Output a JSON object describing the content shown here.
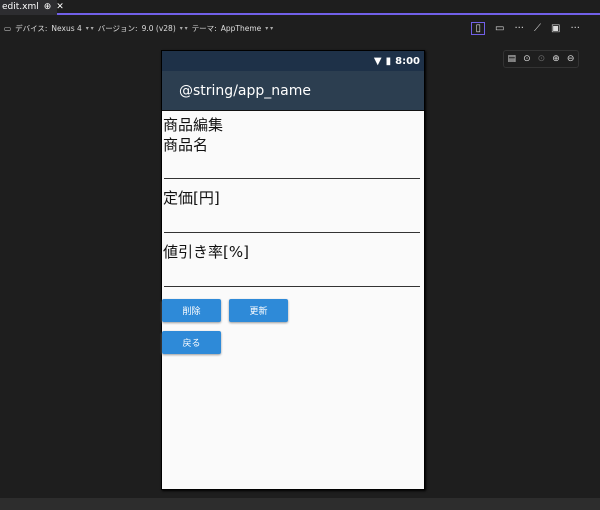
{
  "tab": {
    "title": "edit.xml",
    "pin": "⊕",
    "close": "✕"
  },
  "toolbar": {
    "device_label": "デバイス:",
    "device": "Nexus 4",
    "version_label": "バージョン:",
    "version": "9.0 (v28)",
    "theme_label": "テーマ:",
    "theme": "AppTheme",
    "dd": "▾ ▾",
    "more": "···"
  },
  "zoom": {
    "fit": "▤",
    "zoom_fit": "⊙",
    "zoom_actual": "⊙",
    "zoom_in": "⊕",
    "zoom_out": "⊖"
  },
  "phone": {
    "time": "8:00",
    "app_title": "@string/app_name",
    "heading": "商品編集",
    "label_name": "商品名",
    "label_price": "定価[円]",
    "label_discount": "値引き率[%]",
    "delete": "削除",
    "update": "更新",
    "back": "戻る"
  }
}
